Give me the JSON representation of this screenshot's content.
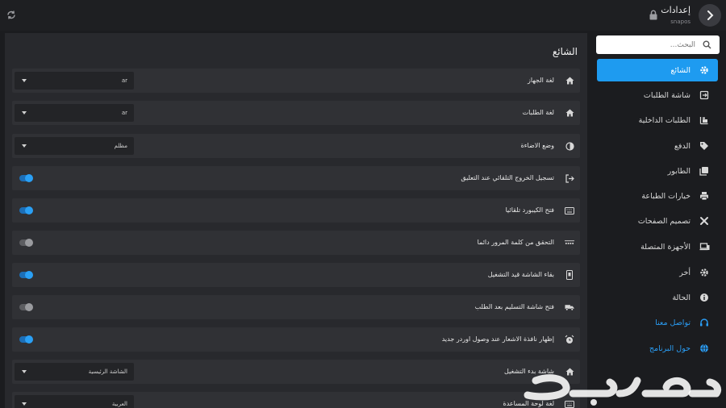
{
  "header": {
    "title": "إعدادات",
    "subtitle": "snapos"
  },
  "sidebar": {
    "search_placeholder": "البحث...",
    "items": [
      {
        "label": "الشائع",
        "icon": "gear-icon",
        "active": true
      },
      {
        "label": "شاشة الطلبات",
        "icon": "order-screen-icon"
      },
      {
        "label": "الطلبات الداخلية",
        "icon": "internal-orders-icon"
      },
      {
        "label": "الدفع",
        "icon": "tag-icon"
      },
      {
        "label": "الطابور",
        "icon": "queue-icon"
      },
      {
        "label": "خيارات الطباعة",
        "icon": "printer-icon"
      },
      {
        "label": "تصميم الصفحات",
        "icon": "design-tools-icon"
      },
      {
        "label": "الأجهزة المتصلة",
        "icon": "devices-icon"
      },
      {
        "label": "أخر",
        "icon": "gear-icon"
      },
      {
        "label": "الحالة",
        "icon": "info-icon"
      },
      {
        "label": "تواصل معنا",
        "icon": "headset-icon",
        "link": true
      },
      {
        "label": "حول البرنامج",
        "icon": "globe-icon",
        "link": true
      }
    ]
  },
  "main": {
    "section_title": "الشائع",
    "rows": [
      {
        "label": "لغة الجهاز",
        "icon": "home-icon",
        "control": "select",
        "value": "ar"
      },
      {
        "label": "لغة الطلبات",
        "icon": "home-icon",
        "control": "select",
        "value": "ar"
      },
      {
        "label": "وضع الاضاءة",
        "icon": "contrast-icon",
        "control": "select",
        "value": "مظلم"
      },
      {
        "label": "تسجيل الخروج التلقائي عند التعليق",
        "icon": "logout-icon",
        "control": "toggle",
        "on": true
      },
      {
        "label": "فتح الكيبورد تلقائيا",
        "icon": "keyboard-icon",
        "control": "toggle",
        "on": true
      },
      {
        "label": "التحقق من كلمة المرور دائما",
        "icon": "password-icon",
        "control": "toggle",
        "on": false
      },
      {
        "label": "بقاء الشاشة قيد التشغيل",
        "icon": "phone-icon",
        "control": "toggle",
        "on": true
      },
      {
        "label": "فتح شاشة التسليم بعد الطلب",
        "icon": "delivery-icon",
        "control": "toggle",
        "on": false
      },
      {
        "label": "إظهار نافذة الاشعار عند وصول اوردر جديد",
        "icon": "alarm-icon",
        "control": "toggle",
        "on": true
      },
      {
        "label": "شاشة بدء التشغيل",
        "icon": "home-icon",
        "control": "select",
        "value": "الشاشة الرئيسية"
      },
      {
        "label": "لغة لوحة المساعدة",
        "icon": "keyboard-icon",
        "control": "select",
        "value": "العربية"
      }
    ]
  },
  "watermark": {
    "text": "حراج"
  },
  "colors": {
    "accent": "#1e9bf0",
    "background": "#1b1c1f",
    "panel": "#28292d",
    "row": "#303135"
  }
}
